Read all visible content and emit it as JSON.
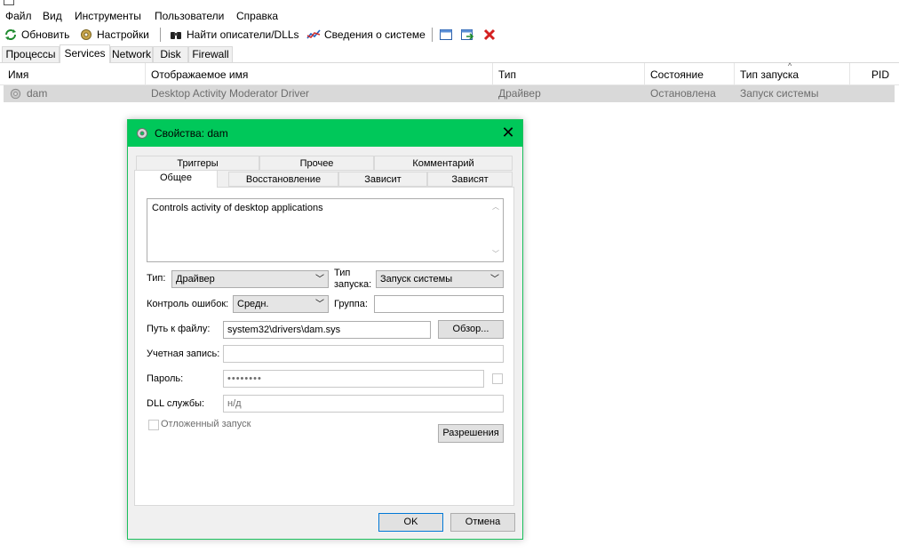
{
  "menu": [
    "Файл",
    "Вид",
    "Инструменты",
    "Пользователи",
    "Справка"
  ],
  "toolbar": {
    "refresh": "Обновить",
    "options": "Настройки",
    "find": "Найти описатели/DLLs",
    "sysinfo": "Сведения о системе"
  },
  "main_tabs": [
    "Процессы",
    "Services",
    "Network",
    "Disk",
    "Firewall"
  ],
  "columns": [
    "Имя",
    "Отображаемое имя",
    "Тип",
    "Состояние",
    "Тип запуска",
    "PID"
  ],
  "service": {
    "name": "dam",
    "display_name": "Desktop Activity Moderator Driver",
    "type": "Драйвер",
    "status": "Остановлена",
    "start_type": "Запуск системы",
    "pid": ""
  },
  "dialog": {
    "title": "Свойства: dam",
    "tabs_row1": [
      "Триггеры",
      "Прочее",
      "Комментарий"
    ],
    "tabs_row2": [
      "Общее",
      "Восстановление",
      "Зависит",
      "Зависят"
    ],
    "description": "Controls activity of desktop applications",
    "type_label": "Тип:",
    "type_value": "Драйвер",
    "start_label_1": "Тип",
    "start_label_2": "запуска:",
    "start_value": "Запуск системы",
    "error_label": "Контроль ошибок:",
    "error_value": "Средн.",
    "group_label": "Группа:",
    "group_value": "",
    "path_label": "Путь к файлу:",
    "path_value": "system32\\drivers\\dam.sys",
    "browse": "Обзор...",
    "account_label": "Учетная запись:",
    "account_value": "",
    "password_label": "Пароль:",
    "password_value": "••••••••",
    "dll_label": "DLL службы:",
    "dll_value": "н/д",
    "delayed": "Отложенный запуск",
    "permissions": "Разрешения",
    "ok": "OK",
    "cancel": "Отмена"
  }
}
